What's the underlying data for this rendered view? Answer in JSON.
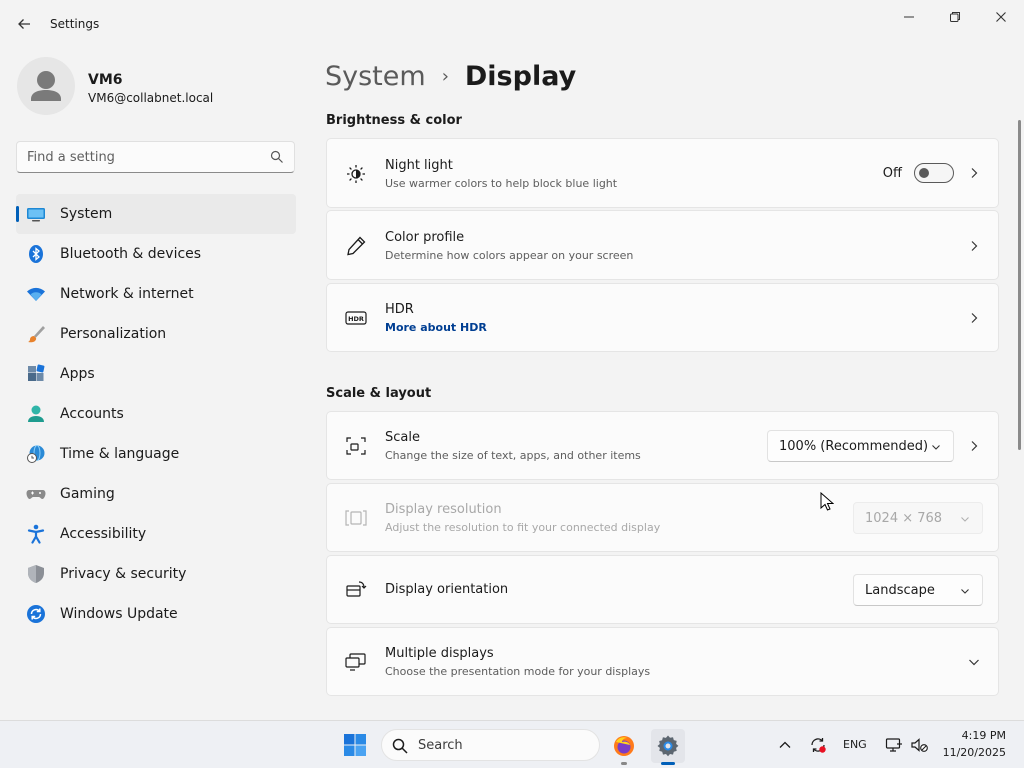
{
  "window": {
    "title": "Settings"
  },
  "profile": {
    "name": "VM6",
    "email": "VM6@collabnet.local"
  },
  "search": {
    "placeholder": "Find a setting"
  },
  "nav": {
    "items": [
      {
        "label": "System",
        "icon": "monitor-icon",
        "active": true
      },
      {
        "label": "Bluetooth & devices",
        "icon": "bluetooth-icon"
      },
      {
        "label": "Network & internet",
        "icon": "wifi-icon"
      },
      {
        "label": "Personalization",
        "icon": "brush-icon"
      },
      {
        "label": "Apps",
        "icon": "apps-icon"
      },
      {
        "label": "Accounts",
        "icon": "person-icon"
      },
      {
        "label": "Time & language",
        "icon": "globe-clock-icon"
      },
      {
        "label": "Gaming",
        "icon": "gamepad-icon"
      },
      {
        "label": "Accessibility",
        "icon": "accessibility-icon"
      },
      {
        "label": "Privacy & security",
        "icon": "shield-icon"
      },
      {
        "label": "Windows Update",
        "icon": "update-icon"
      }
    ]
  },
  "breadcrumb": {
    "parent": "System",
    "separator": "›",
    "current": "Display"
  },
  "sections": {
    "brightness": "Brightness & color",
    "scale_layout": "Scale & layout"
  },
  "cards": {
    "night_light": {
      "title": "Night light",
      "subtitle": "Use warmer colors to help block blue light",
      "toggle_state": "Off",
      "toggle_on": false,
      "icon": "brightness-icon"
    },
    "color_profile": {
      "title": "Color profile",
      "subtitle": "Determine how colors appear on your screen",
      "icon": "pen-icon"
    },
    "hdr": {
      "title": "HDR",
      "link": "More about HDR",
      "icon": "hdr-icon"
    },
    "scale": {
      "title": "Scale",
      "subtitle": "Change the size of text, apps, and other items",
      "value": "100% (Recommended)",
      "icon": "scale-icon"
    },
    "resolution": {
      "title": "Display resolution",
      "subtitle": "Adjust the resolution to fit your connected display",
      "value": "1024 × 768",
      "disabled": true,
      "icon": "resolution-icon"
    },
    "orientation": {
      "title": "Display orientation",
      "value": "Landscape",
      "icon": "orientation-icon"
    },
    "multiple": {
      "title": "Multiple displays",
      "subtitle": "Choose the presentation mode for your displays",
      "icon": "multiple-displays-icon"
    }
  },
  "taskbar": {
    "search_label": "Search",
    "language": "ENG",
    "time": "4:19 PM",
    "date": "11/20/2025"
  },
  "colors": {
    "accent": "#005fb8",
    "link": "#003e92",
    "background": "#f3f3f3",
    "card": "#fbfbfb"
  }
}
